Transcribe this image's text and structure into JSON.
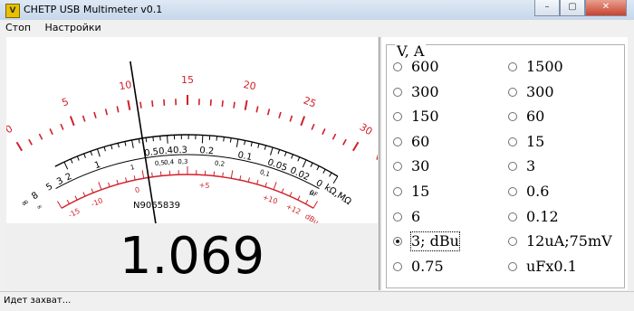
{
  "window": {
    "title": "CHETP USB Multimeter v0.1"
  },
  "menu": [
    "Стоп",
    "Настройки"
  ],
  "meter": {
    "top_scale_labels": [
      "0",
      "5",
      "10",
      "15",
      "20",
      "25",
      "30",
      "V, A"
    ],
    "ohm_scale_labels": [
      "∞",
      "8",
      "5",
      "3",
      "2",
      "1",
      "0.5",
      "0.4",
      "0.3",
      "0.2",
      "0.1",
      "0.05",
      "0.02",
      "0",
      "kΩ,MΩ"
    ],
    "cap_scale_labels": [
      "∞",
      "1",
      "0,5",
      "0,4",
      "0,3",
      "0,2",
      "0,1",
      "0",
      "μF"
    ],
    "dbu_scale_labels": [
      "-15",
      "-10",
      "0",
      "+5",
      "+10",
      "+12",
      "dBu"
    ],
    "serial": "N9065839",
    "needle_value": 10.69,
    "scale_max": 30,
    "reading": "1.069"
  },
  "ranges": {
    "title": "V, A",
    "selected": "3; dBu",
    "left": [
      "600",
      "300",
      "150",
      "60",
      "30",
      "15",
      "6",
      "3; dBu",
      "0.75"
    ],
    "right": [
      "1500",
      "300",
      "60",
      "15",
      "3",
      "0.6",
      "0.12",
      "12uA;75mV",
      "uFx0.1"
    ]
  },
  "status": {
    "text": "Идет захват..."
  }
}
